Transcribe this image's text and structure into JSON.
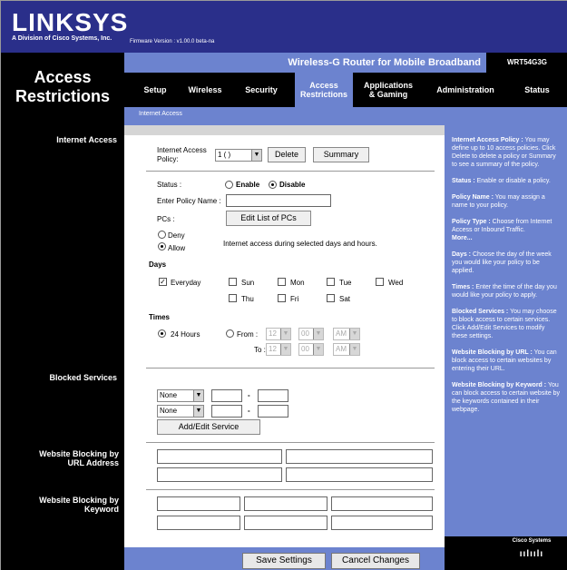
{
  "header": {
    "logo": "LINKSYS",
    "logo_sub": "A Division of Cisco Systems, Inc.",
    "firmware": "Firmware Version : v1.00.0 beta-na",
    "product_name": "Wireless-G Router for Mobile Broadband",
    "model": "WRT54G3G",
    "section_title": "Access Restrictions"
  },
  "tabs": [
    {
      "label": "Setup"
    },
    {
      "label": "Wireless"
    },
    {
      "label": "Security"
    },
    {
      "label": "Access Restrictions"
    },
    {
      "label": "Applications & Gaming"
    },
    {
      "label": "Administration"
    },
    {
      "label": "Status"
    }
  ],
  "subtab": "Internet Access",
  "left_labels": {
    "internet_access": "Internet Access",
    "blocked_services": "Blocked Services",
    "website_url": "Website Blocking by URL Address",
    "website_keyword": "Website Blocking by Keyword"
  },
  "policy": {
    "label": "Internet Access Policy:",
    "selected": "1 ( )",
    "delete_label": "Delete",
    "summary_label": "Summary"
  },
  "status": {
    "label": "Status :",
    "enable": "Enable",
    "disable": "Disable"
  },
  "policy_name": {
    "label": "Enter Policy Name :",
    "value": ""
  },
  "pcs": {
    "label": "PCs :",
    "edit_label": "Edit List of PCs"
  },
  "access": {
    "deny": "Deny",
    "allow": "Allow",
    "desc": "Internet access during selected days and hours."
  },
  "days": {
    "title": "Days",
    "everyday": "Everyday",
    "sun": "Sun",
    "mon": "Mon",
    "tue": "Tue",
    "wed": "Wed",
    "thu": "Thu",
    "fri": "Fri",
    "sat": "Sat"
  },
  "times": {
    "title": "Times",
    "hours24": "24 Hours",
    "from": "From :",
    "to": "To :",
    "hour": "12",
    "minute": "00",
    "ampm": "AM"
  },
  "services": {
    "option1": "None",
    "option2": "None",
    "dash": "-",
    "add_edit_label": "Add/Edit Service"
  },
  "footer": {
    "save_label": "Save Settings",
    "cancel_label": "Cancel Changes"
  },
  "help": {
    "p1_title": "Internet Access Policy :",
    "p1_text": "You may define up to 10 access policies. Click Delete to delete a policy or Summary to see a summary of the policy.",
    "p2_title": "Status :",
    "p2_text": "Enable or disable a policy.",
    "p3_title": "Policy Name :",
    "p3_text": "You may assign a name to your policy.",
    "p4_title": "Policy Type :",
    "p4_text": "Choose from Internet Access or Inbound Traffic.",
    "more": "More...",
    "p5_title": "Days :",
    "p5_text": "Choose the day of the week you would like your policy to be applied.",
    "p6_title": "Times :",
    "p6_text": "Enter the time of the day you would like your policy to apply.",
    "p7_title": "Blocked Services :",
    "p7_text": "You may choose to block access to certain services. Click Add/Edit Services to modify these settings.",
    "p8_title": "Website Blocking by URL :",
    "p8_text": "You can block access to certain websites by entering their URL.",
    "p9_title": "Website Blocking by Keyword :",
    "p9_text": "You can block access to certain website by the keywords contained in their webpage."
  },
  "cisco": "Cisco Systems",
  "colors": {
    "header_blue": "#2a2f8a",
    "accent_blue": "#6c83cf",
    "black": "#000000"
  }
}
